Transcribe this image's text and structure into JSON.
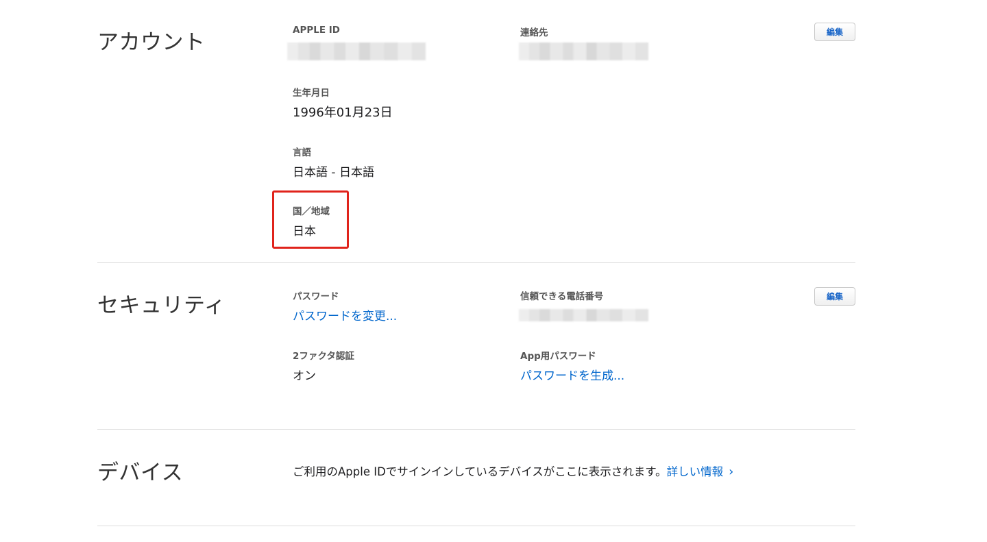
{
  "account": {
    "title": "アカウント",
    "apple_id_label": "APPLE ID",
    "contact_label": "連絡先",
    "edit_label": "編集",
    "birthday_label": "生年月日",
    "birthday_value": "1996年01月23日",
    "language_label": "言語",
    "language_value": "日本語 - 日本語",
    "region_label": "国／地域",
    "region_value": "日本"
  },
  "security": {
    "title": "セキュリティ",
    "password_label": "パスワード",
    "password_link": "パスワードを変更...",
    "trusted_phone_label": "信頼できる電話番号",
    "edit_label": "編集",
    "two_factor_label": "2ファクタ認証",
    "two_factor_value": "オン",
    "app_password_label": "App用パスワード",
    "app_password_link": "パスワードを生成..."
  },
  "devices": {
    "title": "デバイス",
    "description": "ご利用のApple IDでサインインしているデバイスがここに表示されます。",
    "more_link": "詳しい情報",
    "chevron": "›"
  },
  "colors": {
    "link": "#0066cc",
    "highlight": "#e0231b"
  }
}
